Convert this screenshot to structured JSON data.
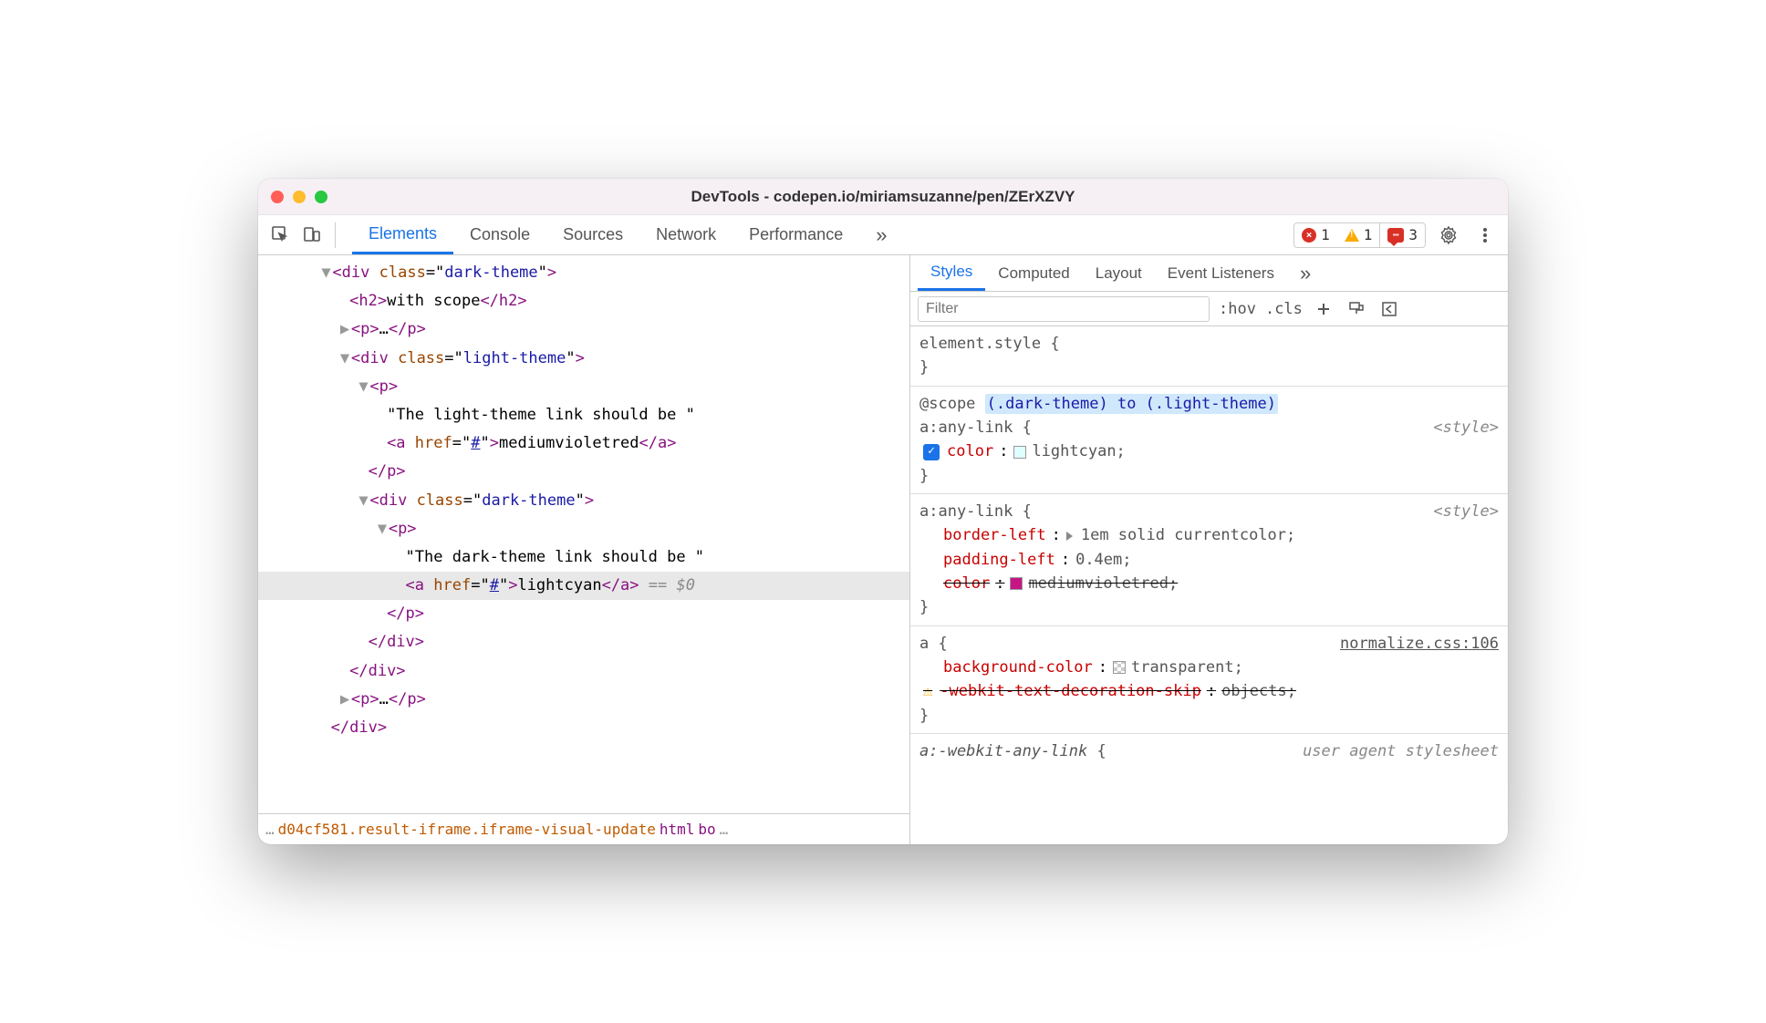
{
  "window": {
    "title": "DevTools - codepen.io/miriamsuzanne/pen/ZErXZVY"
  },
  "tabs": [
    "Elements",
    "Console",
    "Sources",
    "Network",
    "Performance"
  ],
  "active_tab": "Elements",
  "status": {
    "errors": "1",
    "warnings": "1",
    "messages": "3"
  },
  "dom": {
    "l1": {
      "open": "<div",
      "attr": "class",
      "val": "dark-theme",
      "close": ">"
    },
    "l2": {
      "open": "<h2>",
      "txt": "with scope",
      "close": "</h2>"
    },
    "l3": {
      "open": "<p>",
      "dots": "…",
      "close": "</p>"
    },
    "l4": {
      "open": "<div",
      "attr": "class",
      "val": "light-theme",
      "close": ">"
    },
    "l5": {
      "open": "<p>"
    },
    "l6": {
      "txt": "\"The light-theme link should be \""
    },
    "l7": {
      "open": "<a",
      "attr": "href",
      "val": "#",
      "mid": ">",
      "txt": "mediumvioletred",
      "close": "</a>"
    },
    "l8": {
      "close": "</p>"
    },
    "l9": {
      "open": "<div",
      "attr": "class",
      "val": "dark-theme",
      "close": ">"
    },
    "l10": {
      "open": "<p>"
    },
    "l11": {
      "txt": "\"The dark-theme link should be \""
    },
    "l12": {
      "open": "<a",
      "attr": "href",
      "val": "#",
      "mid": ">",
      "txt": "lightcyan",
      "close": "</a>",
      "marker": " == $0"
    },
    "l13": {
      "close": "</p>"
    },
    "l14": {
      "close": "</div>"
    },
    "l15": {
      "close": "</div>"
    },
    "l16": {
      "open": "<p>",
      "dots": "…",
      "close": "</p>"
    },
    "l17": {
      "close": "</div>"
    }
  },
  "breadcrumb": {
    "dots": "…",
    "main": "d04cf581.result-iframe.iframe-visual-update",
    "item1": "html",
    "item2": "bo",
    "trail": "…"
  },
  "subtabs": [
    "Styles",
    "Computed",
    "Layout",
    "Event Listeners"
  ],
  "active_subtab": "Styles",
  "filter": {
    "placeholder": "Filter",
    "hov": ":hov",
    "cls": ".cls"
  },
  "rules": {
    "r0": {
      "sel": "element.style",
      "brace_o": "{",
      "brace_c": "}"
    },
    "r1": {
      "scope_pre": "@scope",
      "scope_hl": "(.dark-theme) to (.light-theme)",
      "sel": "a:any-link",
      "brace_o": "{",
      "src": "<style>",
      "p1_name": "color",
      "p1_val": "lightcyan;",
      "brace_c": "}"
    },
    "r2": {
      "sel": "a:any-link",
      "brace_o": "{",
      "src": "<style>",
      "p1_name": "border-left",
      "p1_val": "1em solid currentcolor;",
      "p2_name": "padding-left",
      "p2_val": "0.4em;",
      "p3_name": "color",
      "p3_val": "mediumvioletred;",
      "brace_c": "}"
    },
    "r3": {
      "sel": "a",
      "brace_o": "{",
      "src": "normalize.css:106",
      "p1_name": "background-color",
      "p1_val": "transparent;",
      "p2_name": "-webkit-text-decoration-skip",
      "p2_val": "objects;",
      "brace_c": "}"
    },
    "r4": {
      "sel": "a:-webkit-any-link",
      "brace_o": "{",
      "src": "user agent stylesheet"
    }
  },
  "colors": {
    "lightcyan": "#e0ffff",
    "mediumvioletred": "#c71585",
    "transparent": "#ffffff"
  }
}
